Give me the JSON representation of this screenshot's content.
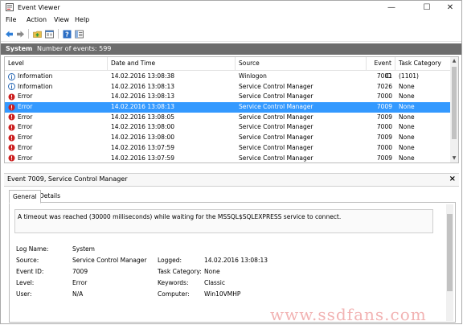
{
  "window": {
    "title": "Event Viewer",
    "controls": [
      "—",
      "☐",
      "✕"
    ]
  },
  "menu": [
    "File",
    "Action",
    "View",
    "Help"
  ],
  "log_header": {
    "name": "System",
    "count_text": "Number of events: 599"
  },
  "grid": {
    "columns": [
      "Level",
      "Date and Time",
      "Source",
      "Event ID",
      "Task Category"
    ],
    "rows": [
      {
        "level": "Information",
        "type": "info",
        "datetime": "14.02.2016 13:08:38",
        "source": "Winlogon",
        "event_id": "7001",
        "category": "(1101)"
      },
      {
        "level": "Information",
        "type": "info",
        "datetime": "14.02.2016 13:08:13",
        "source": "Service Control Manager",
        "event_id": "7026",
        "category": "None"
      },
      {
        "level": "Error",
        "type": "error",
        "datetime": "14.02.2016 13:08:13",
        "source": "Service Control Manager",
        "event_id": "7000",
        "category": "None"
      },
      {
        "level": "Error",
        "type": "error",
        "datetime": "14.02.2016 13:08:13",
        "source": "Service Control Manager",
        "event_id": "7009",
        "category": "None",
        "selected": true
      },
      {
        "level": "Error",
        "type": "error",
        "datetime": "14.02.2016 13:08:05",
        "source": "Service Control Manager",
        "event_id": "7009",
        "category": "None"
      },
      {
        "level": "Error",
        "type": "error",
        "datetime": "14.02.2016 13:08:00",
        "source": "Service Control Manager",
        "event_id": "7000",
        "category": "None"
      },
      {
        "level": "Error",
        "type": "error",
        "datetime": "14.02.2016 13:08:00",
        "source": "Service Control Manager",
        "event_id": "7009",
        "category": "None"
      },
      {
        "level": "Error",
        "type": "error",
        "datetime": "14.02.2016 13:07:59",
        "source": "Service Control Manager",
        "event_id": "7000",
        "category": "None"
      },
      {
        "level": "Error",
        "type": "error",
        "datetime": "14.02.2016 13:07:59",
        "source": "Service Control Manager",
        "event_id": "7009",
        "category": "None"
      }
    ]
  },
  "detail": {
    "title": "Event 7009, Service Control Manager",
    "close": "×",
    "tabs": [
      "General",
      "Details"
    ],
    "message": "A timeout was reached (30000 milliseconds) while waiting for the MSSQL$SQLEXPRESS service to connect.",
    "fields": {
      "log_name_label": "Log Name:",
      "log_name": "System",
      "source_label": "Source:",
      "source": "Service Control Manager",
      "logged_label": "Logged:",
      "logged": "14.02.2016 13:08:13",
      "event_id_label": "Event ID:",
      "event_id": "7009",
      "task_category_label": "Task Category:",
      "task_category": "None",
      "level_label": "Level:",
      "level": "Error",
      "keywords_label": "Keywords:",
      "keywords": "Classic",
      "user_label": "User:",
      "user": "N/A",
      "computer_label": "Computer:",
      "computer": "Win10VMHP"
    }
  },
  "watermark": "www.ssdfans.com",
  "colors": {
    "selection": "#3399ff",
    "header_bar": "#6d6d6d",
    "error": "#cc1f1f",
    "info": "#1c5fb0"
  }
}
